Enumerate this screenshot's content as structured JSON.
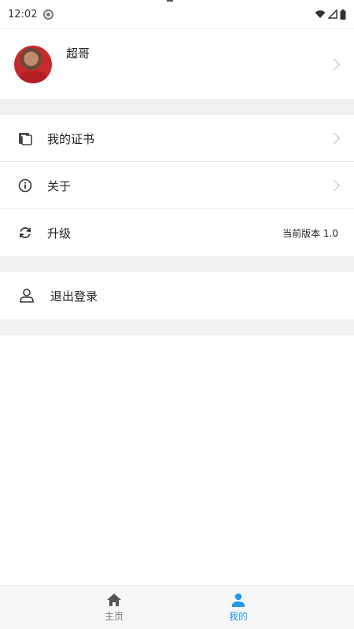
{
  "status_bar": {
    "time": "12:02"
  },
  "profile": {
    "name": "超哥"
  },
  "menu": {
    "certificates": {
      "label": "我的证书"
    },
    "about": {
      "label": "关于"
    },
    "upgrade": {
      "label": "升级",
      "version": "当前版本 1.0"
    },
    "logout": {
      "label": "退出登录"
    }
  },
  "bottom_nav": {
    "home": {
      "label": "主页"
    },
    "me": {
      "label": "我的"
    }
  },
  "colors": {
    "accent": "#2196f3",
    "divider": "#f0f0f0"
  }
}
